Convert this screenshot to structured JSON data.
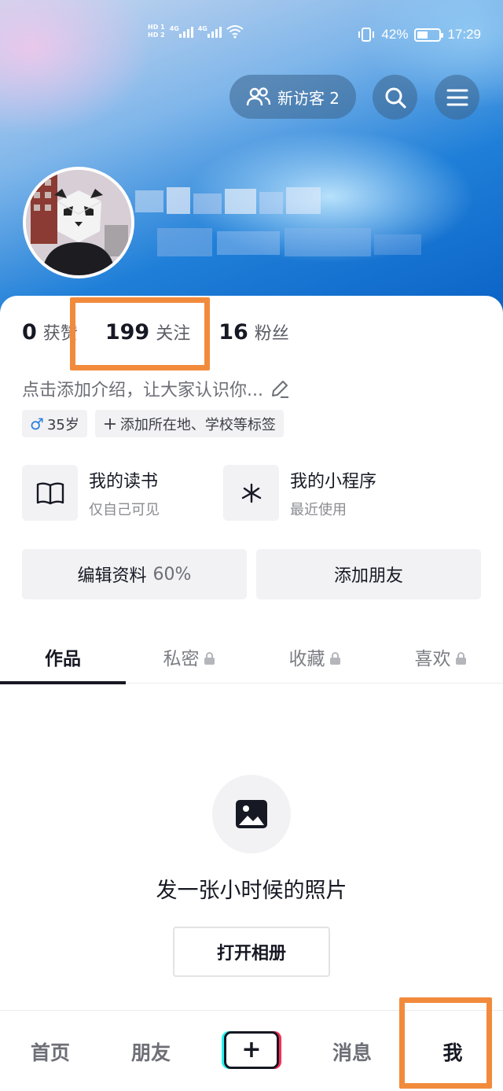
{
  "status_bar": {
    "hd1": "HD 1",
    "hd2": "HD 2",
    "net1": "4G",
    "net2": "4G",
    "battery_pct": "42%",
    "battery_level": 0.42,
    "time": "17:29",
    "icons": [
      "signal-icon",
      "wifi-icon",
      "vibrate-icon",
      "battery-icon"
    ]
  },
  "header": {
    "visitor_label": "新访客 2",
    "search_icon": "search-icon",
    "menu_icon": "menu-icon"
  },
  "stats": [
    {
      "num": "0",
      "label": "获赞"
    },
    {
      "num": "199",
      "label": "关注"
    },
    {
      "num": "16",
      "label": "粉丝"
    }
  ],
  "bio": {
    "text": "点击添加介绍，让大家认识你...",
    "icon": "edit-icon"
  },
  "tags": {
    "gender_symbol": "♂",
    "age": "35岁",
    "add_tag": "添加所在地、学校等标签"
  },
  "features": [
    {
      "title": "我的读书",
      "sub": "仅自己可见",
      "icon": "book-icon"
    },
    {
      "title": "我的小程序",
      "sub": "最近使用",
      "icon": "mini-program-icon"
    }
  ],
  "actions": {
    "edit_profile": "编辑资料",
    "edit_pct": "60%",
    "add_friend": "添加朋友"
  },
  "tabs": [
    {
      "label": "作品",
      "locked": false
    },
    {
      "label": "私密",
      "locked": true
    },
    {
      "label": "收藏",
      "locked": true
    },
    {
      "label": "喜欢",
      "locked": true
    }
  ],
  "empty": {
    "icon": "image-icon",
    "text": "发一张小时候的照片",
    "button": "打开相册"
  },
  "nav": {
    "home": "首页",
    "friends": "朋友",
    "create": "+",
    "messages": "消息",
    "me": "我"
  },
  "colors": {
    "highlight": "#f28a3c",
    "male": "#2a7ddf",
    "text": "#161823"
  }
}
